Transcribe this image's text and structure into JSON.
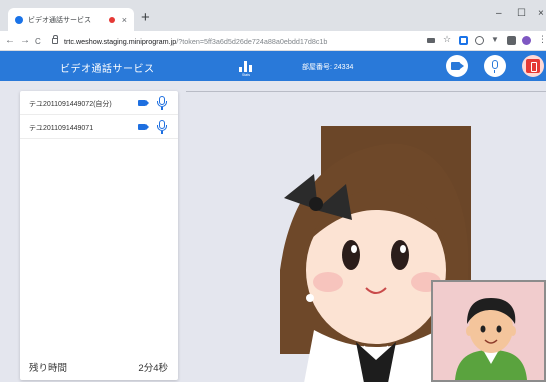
{
  "browser": {
    "tab_title": "ビデオ通話サービス",
    "tab_close": "×",
    "new_tab": "+",
    "window_controls": [
      "–",
      "☐",
      "×"
    ],
    "nav": {
      "back": "←",
      "forward": "→",
      "reload": "C"
    },
    "url_host": "trtc.weshow.staging.miniprogram.jp",
    "url_path": "/?token=5ff3a6d5d26de724a88a0ebdd17d8c1b"
  },
  "app": {
    "title": "ビデオ通話サービス",
    "stats_label": "Stats",
    "room_label": "部屋番号: 24334"
  },
  "participants": [
    {
      "name": "テユ2011091449072(自分)"
    },
    {
      "name": "テユ2011091449071"
    }
  ],
  "remaining": {
    "label": "残り時間",
    "value": "2分4秒"
  },
  "colors": {
    "header": "#2979d9",
    "accent": "#1e6fe0",
    "exit": "#e53935",
    "pip_bg": "#f1cccd"
  }
}
